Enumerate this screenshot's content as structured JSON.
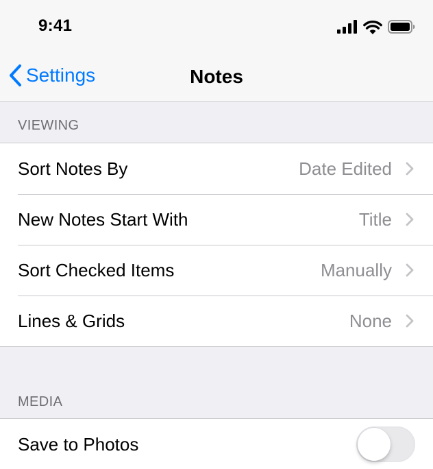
{
  "status_bar": {
    "time": "9:41",
    "icons": [
      "cellular-signal-icon",
      "wifi-icon",
      "battery-icon"
    ]
  },
  "nav": {
    "back_label": "Settings",
    "title": "Notes"
  },
  "sections": [
    {
      "header": "VIEWING",
      "rows": [
        {
          "label": "Sort Notes By",
          "value": "Date Edited"
        },
        {
          "label": "New Notes Start With",
          "value": "Title"
        },
        {
          "label": "Sort Checked Items",
          "value": "Manually"
        },
        {
          "label": "Lines & Grids",
          "value": "None"
        }
      ]
    },
    {
      "header": "MEDIA",
      "rows": [
        {
          "label": "Save to Photos",
          "toggle_on": false
        }
      ]
    }
  ],
  "colors": {
    "accent": "#007aff",
    "background": "#efeff4",
    "secondary_text": "#8e8e93"
  }
}
